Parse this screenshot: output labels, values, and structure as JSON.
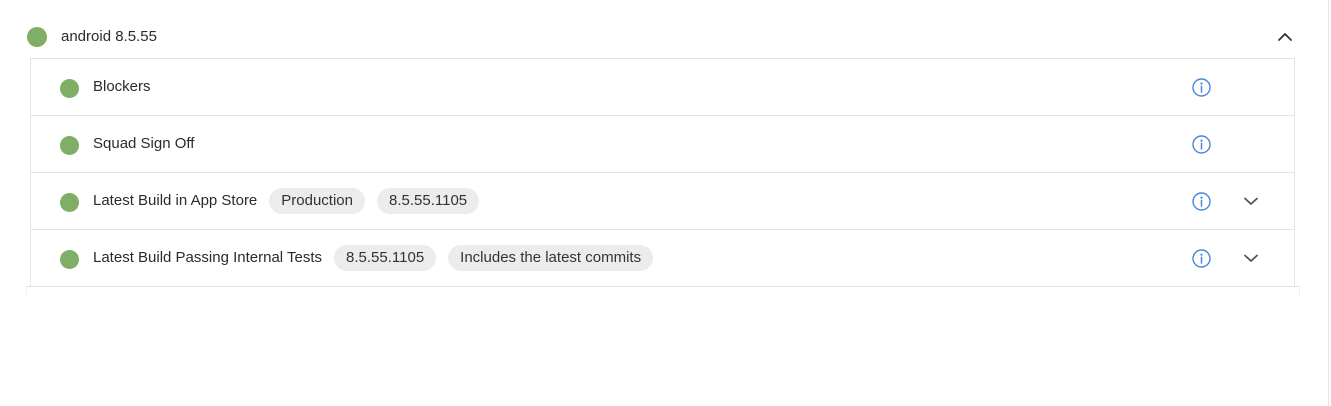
{
  "colors": {
    "status_ok": "#7fae67",
    "info_accent": "#4a86d9",
    "chip_bg": "#ececec",
    "border": "#e4e4e4"
  },
  "group": {
    "title": "android 8.5.55",
    "status": "ok",
    "expanded": true,
    "toggle_icon": "chevron-up-icon"
  },
  "rows": [
    {
      "label": "Blockers",
      "status": "ok",
      "chips": [],
      "info_icon": "info-icon",
      "expandable": false
    },
    {
      "label": "Squad Sign Off",
      "status": "ok",
      "chips": [],
      "info_icon": "info-icon",
      "expandable": false
    },
    {
      "label": "Latest Build in App Store",
      "status": "ok",
      "chips": [
        "Production",
        "8.5.55.1105"
      ],
      "info_icon": "info-icon",
      "expandable": true,
      "expand_icon": "chevron-down-icon"
    },
    {
      "label": "Latest Build Passing Internal Tests",
      "status": "ok",
      "chips": [
        "8.5.55.1105",
        "Includes the latest commits"
      ],
      "info_icon": "info-icon",
      "expandable": true,
      "expand_icon": "chevron-down-icon"
    }
  ]
}
